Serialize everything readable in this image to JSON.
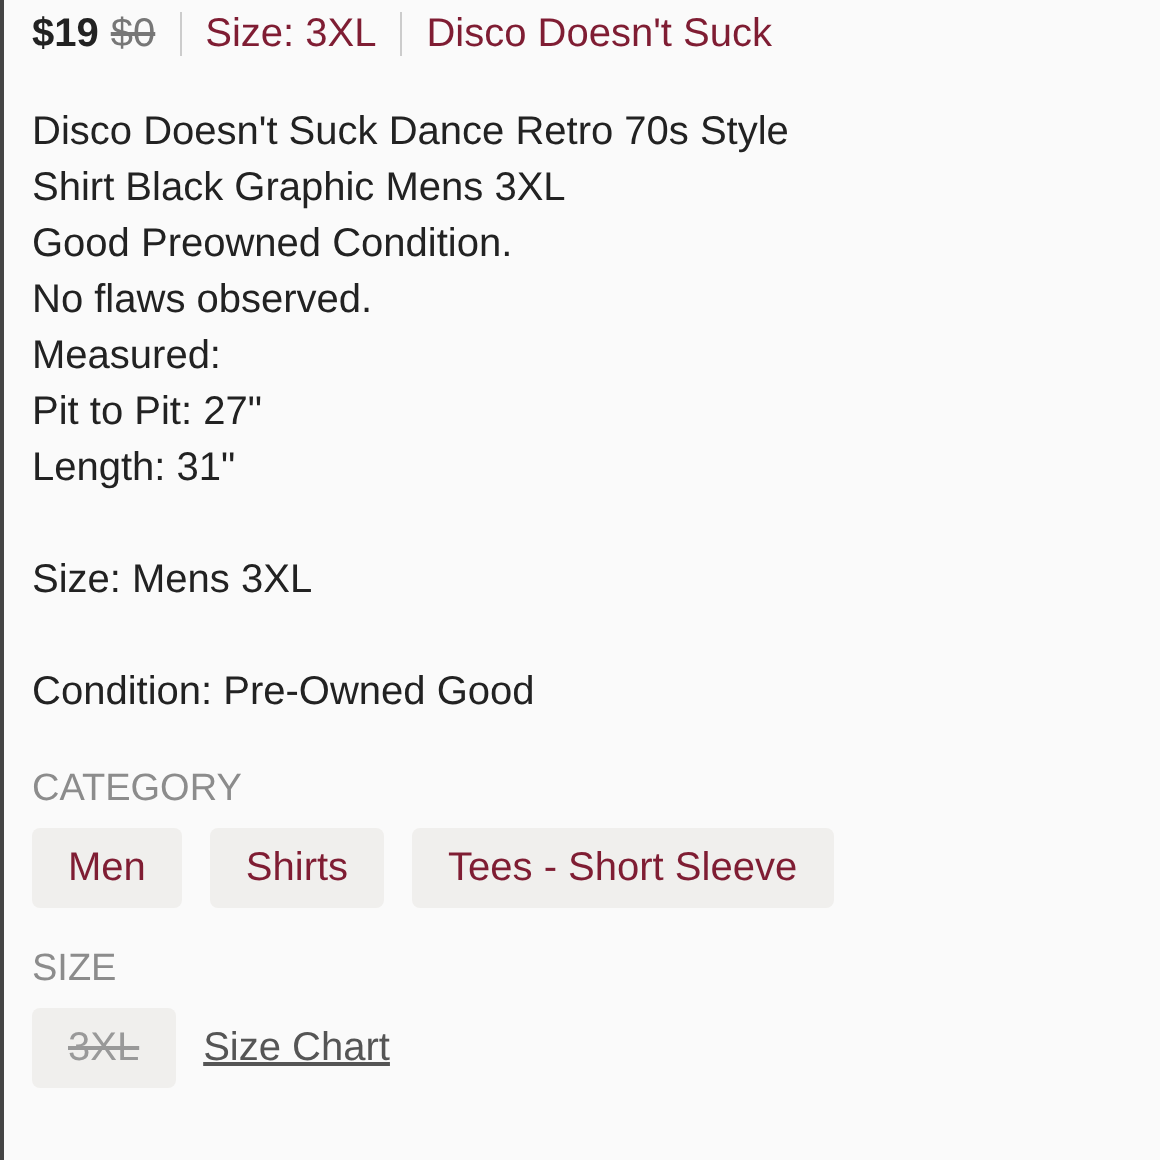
{
  "header": {
    "price": "$19",
    "original_price": "$0",
    "size": "Size: 3XL",
    "brand": "Disco Doesn't Suck"
  },
  "description": [
    [
      "Disco Doesn't Suck Dance Retro 70s Style",
      "Shirt Black Graphic Mens 3XL",
      "Good Preowned Condition.",
      "No flaws observed.",
      "Measured:",
      "Pit to Pit: 27\"",
      "Length: 31\""
    ],
    [
      "Size: Mens 3XL"
    ],
    [
      "Condition: Pre-Owned Good"
    ]
  ],
  "category": {
    "label": "CATEGORY",
    "items": [
      "Men",
      "Shirts",
      "Tees - Short Sleeve"
    ]
  },
  "size": {
    "label": "SIZE",
    "options": [
      {
        "label": "3XL",
        "available": false
      }
    ],
    "size_chart_link": "Size Chart"
  }
}
